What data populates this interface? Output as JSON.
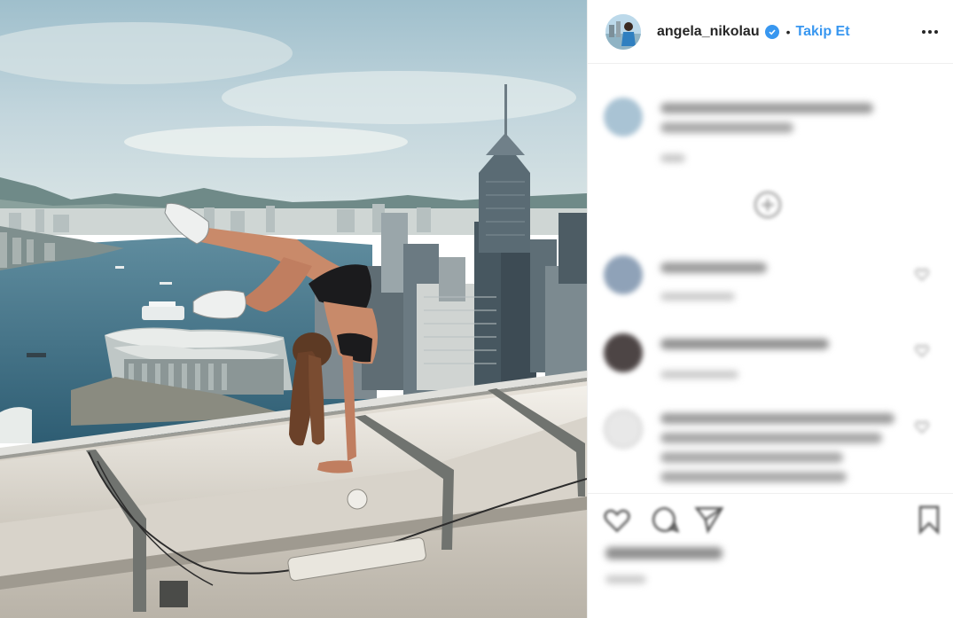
{
  "header": {
    "username": "angela_nikolau",
    "separator": "•",
    "follow_label": "Takip Et"
  },
  "icons": {
    "verified": "verified-badge-icon",
    "more": "more-options-icon",
    "like": "heart-icon",
    "comment": "comment-bubble-icon",
    "share": "share-arrow-icon",
    "save": "bookmark-icon"
  },
  "colors": {
    "accent": "#3897f0",
    "text": "#262626",
    "divider": "#efefef"
  }
}
